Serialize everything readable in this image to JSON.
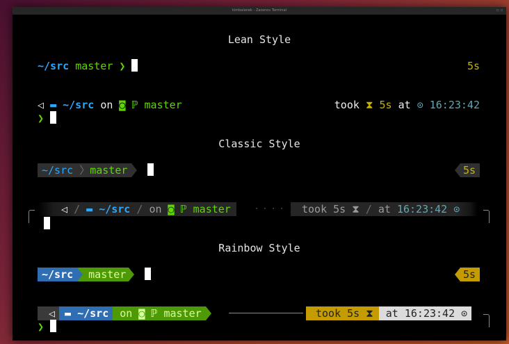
{
  "window": {
    "title": "kimbalanek - Zazanov Terminal",
    "controls": "○ ○"
  },
  "lean": {
    "heading": "Lean Style",
    "line1": {
      "dir": "~/src",
      "branch": "master",
      "prompt": "❯",
      "duration": "5s"
    },
    "line2": {
      "os_icon": "◁",
      "folder_icon": "▬",
      "dir": "~/src",
      "on": "on",
      "git_icon": "◙",
      "branch_icon": "ℙ",
      "branch": "master",
      "took": "took",
      "hourglass": "⧗",
      "duration": "5s",
      "at": "at",
      "clock": "⊙",
      "time": "16:23:42",
      "prompt": "❯"
    }
  },
  "classic": {
    "heading": "Classic Style",
    "line1": {
      "dir": "~/src",
      "branch": "master",
      "duration": "5s"
    },
    "line2": {
      "os_icon": "◁",
      "folder_icon": "▬",
      "dir": "~/src",
      "on": "on",
      "git_icon": "◙",
      "branch_icon": "ℙ",
      "branch": "master",
      "dots": "· · · ·",
      "took": "took",
      "duration": "5s",
      "hourglass": "⧗",
      "at": "at",
      "time": "16:23:42",
      "clock": "⊙"
    }
  },
  "rainbow": {
    "heading": "Rainbow Style",
    "line1": {
      "dir": "~/src",
      "branch": "master",
      "duration": "5s"
    },
    "line2": {
      "os_icon": "◁",
      "folder_icon": "▬",
      "dir": "~/src",
      "on": "on",
      "git_icon": "◙",
      "branch_icon": "ℙ",
      "branch": "master",
      "took": "took",
      "duration": "5s",
      "hourglass": "⧗",
      "at": "at",
      "time": "16:23:42",
      "clock": "⊙",
      "prompt": "❯"
    }
  }
}
